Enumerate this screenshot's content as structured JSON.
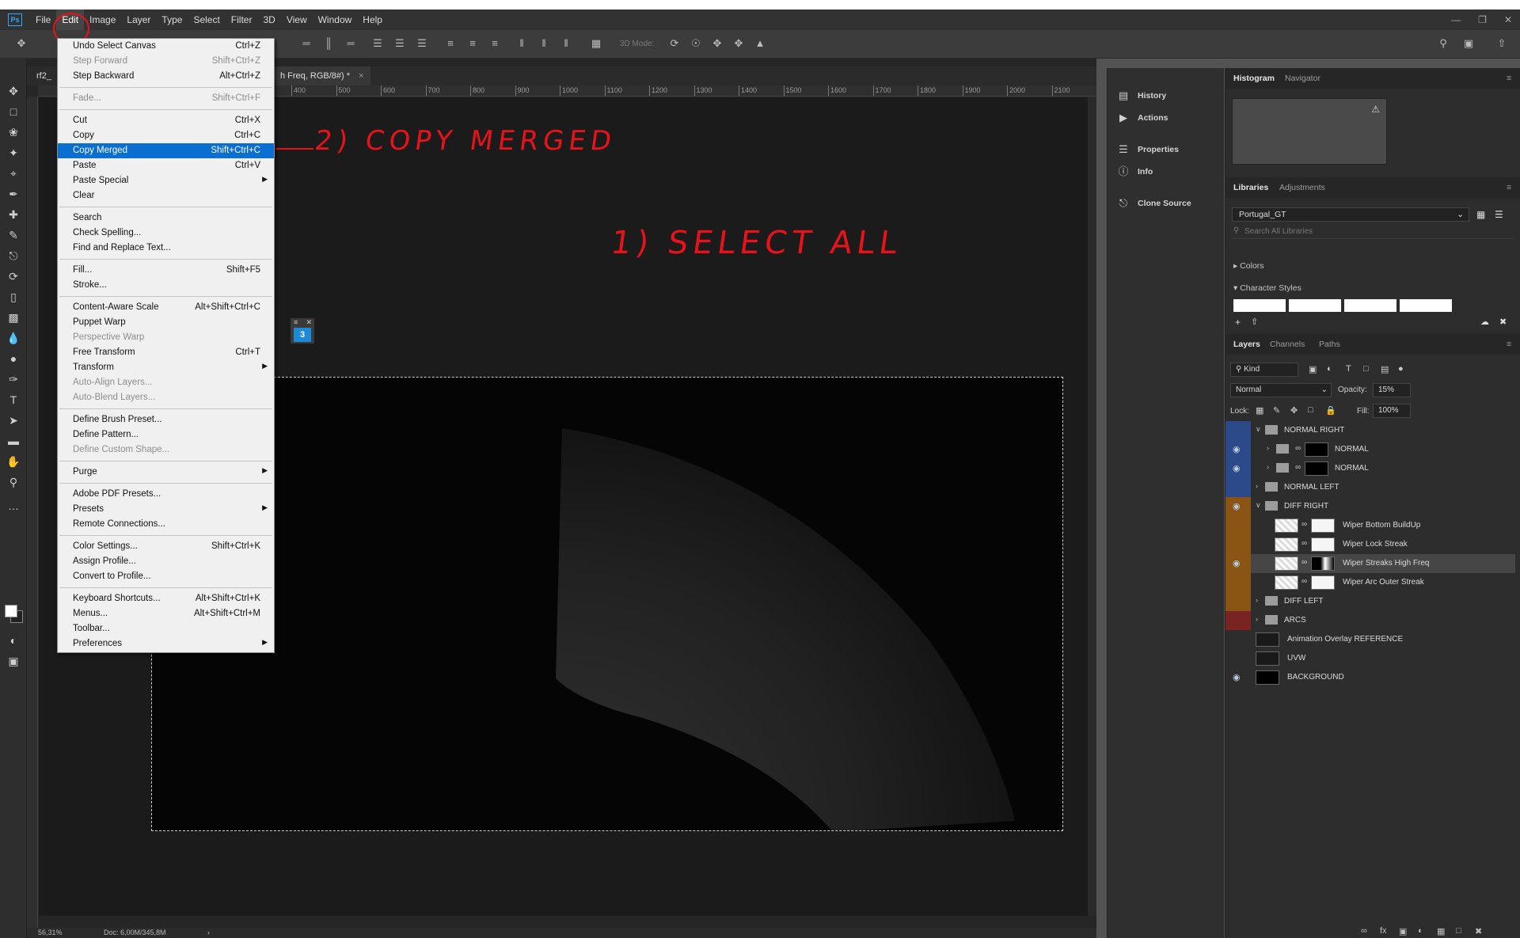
{
  "menubar": {
    "logo": "Ps",
    "items": [
      "File",
      "Edit",
      "Image",
      "Layer",
      "Type",
      "Select",
      "Filter",
      "3D",
      "View",
      "Window",
      "Help"
    ]
  },
  "optionsbar": {
    "mode_3d": "3D Mode:"
  },
  "document": {
    "tab_left": "rf2_",
    "tab_title": "h Freq, RGB/8#) *",
    "tab_close": "×",
    "ruler_ticks": [
      "400",
      "500",
      "600",
      "700",
      "800",
      "900",
      "1000",
      "1100",
      "1200",
      "1300",
      "1400",
      "1500",
      "1600",
      "1700",
      "1800",
      "1900",
      "2000",
      "2100"
    ],
    "zoom": "56,31%",
    "doc_info": "Doc: 6,00M/345,8M",
    "float_badge": "3"
  },
  "annotations": {
    "step1": "1) SELECT  ALL",
    "step2": "2) COPY  MERGED"
  },
  "edit_menu": {
    "items": [
      {
        "label": "Undo Select Canvas",
        "shortcut": "Ctrl+Z",
        "disabled": false
      },
      {
        "label": "Step Forward",
        "shortcut": "Shift+Ctrl+Z",
        "disabled": true
      },
      {
        "label": "Step Backward",
        "shortcut": "Alt+Ctrl+Z",
        "disabled": false
      },
      {
        "sep": true
      },
      {
        "label": "Fade...",
        "shortcut": "Shift+Ctrl+F",
        "disabled": true
      },
      {
        "sep": true
      },
      {
        "label": "Cut",
        "shortcut": "Ctrl+X",
        "disabled": false
      },
      {
        "label": "Copy",
        "shortcut": "Ctrl+C",
        "disabled": false
      },
      {
        "label": "Copy Merged",
        "shortcut": "Shift+Ctrl+C",
        "disabled": false,
        "highlight": true
      },
      {
        "label": "Paste",
        "shortcut": "Ctrl+V",
        "disabled": false
      },
      {
        "label": "Paste Special",
        "shortcut": "",
        "disabled": false,
        "submenu": true
      },
      {
        "label": "Clear",
        "shortcut": "",
        "disabled": false
      },
      {
        "sep": true
      },
      {
        "label": "Search",
        "shortcut": "",
        "disabled": false
      },
      {
        "label": "Check Spelling...",
        "shortcut": "",
        "disabled": false
      },
      {
        "label": "Find and Replace Text...",
        "shortcut": "",
        "disabled": false
      },
      {
        "sep": true
      },
      {
        "label": "Fill...",
        "shortcut": "Shift+F5",
        "disabled": false
      },
      {
        "label": "Stroke...",
        "shortcut": "",
        "disabled": false
      },
      {
        "sep": true
      },
      {
        "label": "Content-Aware Scale",
        "shortcut": "Alt+Shift+Ctrl+C",
        "disabled": false
      },
      {
        "label": "Puppet Warp",
        "shortcut": "",
        "disabled": false
      },
      {
        "label": "Perspective Warp",
        "shortcut": "",
        "disabled": true
      },
      {
        "label": "Free Transform",
        "shortcut": "Ctrl+T",
        "disabled": false
      },
      {
        "label": "Transform",
        "shortcut": "",
        "disabled": false,
        "submenu": true
      },
      {
        "label": "Auto-Align Layers...",
        "shortcut": "",
        "disabled": true
      },
      {
        "label": "Auto-Blend Layers...",
        "shortcut": "",
        "disabled": true
      },
      {
        "sep": true
      },
      {
        "label": "Define Brush Preset...",
        "shortcut": "",
        "disabled": false
      },
      {
        "label": "Define Pattern...",
        "shortcut": "",
        "disabled": false
      },
      {
        "label": "Define Custom Shape...",
        "shortcut": "",
        "disabled": true
      },
      {
        "sep": true
      },
      {
        "label": "Purge",
        "shortcut": "",
        "disabled": false,
        "submenu": true
      },
      {
        "sep": true
      },
      {
        "label": "Adobe PDF Presets...",
        "shortcut": "",
        "disabled": false
      },
      {
        "label": "Presets",
        "shortcut": "",
        "disabled": false,
        "submenu": true
      },
      {
        "label": "Remote Connections...",
        "shortcut": "",
        "disabled": false
      },
      {
        "sep": true
      },
      {
        "label": "Color Settings...",
        "shortcut": "Shift+Ctrl+K",
        "disabled": false
      },
      {
        "label": "Assign Profile...",
        "shortcut": "",
        "disabled": false
      },
      {
        "label": "Convert to Profile...",
        "shortcut": "",
        "disabled": false
      },
      {
        "sep": true
      },
      {
        "label": "Keyboard Shortcuts...",
        "shortcut": "Alt+Shift+Ctrl+K",
        "disabled": false
      },
      {
        "label": "Menus...",
        "shortcut": "Alt+Shift+Ctrl+M",
        "disabled": false
      },
      {
        "label": "Toolbar...",
        "shortcut": "",
        "disabled": false
      },
      {
        "label": "Preferences",
        "shortcut": "",
        "disabled": false,
        "submenu": true
      }
    ]
  },
  "icon_strip": {
    "items": [
      {
        "label": "History",
        "icon": "history-icon"
      },
      {
        "label": "Actions",
        "icon": "play-icon"
      },
      {
        "label": "Properties",
        "icon": "properties-icon"
      },
      {
        "label": "Info",
        "icon": "info-icon"
      },
      {
        "label": "Clone Source",
        "icon": "clone-source-icon"
      }
    ]
  },
  "panels": {
    "top_tabs": [
      "Histogram",
      "Navigator"
    ],
    "lib_tabs": [
      "Libraries",
      "Adjustments"
    ],
    "library_name": "Portugal_GT",
    "search_placeholder": "Search All Libraries",
    "colors_label": "Colors",
    "char_styles_label": "Character Styles",
    "layer_tabs": [
      "Layers",
      "Channels",
      "Paths"
    ],
    "filter_kind": "Kind",
    "blend_mode": "Normal",
    "opacity_label": "Opacity:",
    "opacity_value": "15%",
    "lock_label": "Lock:",
    "fill_label": "Fill:",
    "fill_value": "100%"
  },
  "colors": {
    "accent": "#0a6fd1",
    "annotation": "#e8121a",
    "blue_tag": "#2c4a8a",
    "orange_tag": "#8a5414",
    "red_tag": "#7a2323"
  },
  "layers": [
    {
      "name": "NORMAL RIGHT",
      "type": "group",
      "indent": 0,
      "tag": "blue",
      "eye": false,
      "open": true
    },
    {
      "name": "NORMAL",
      "type": "group",
      "indent": 1,
      "tag": "blue",
      "eye": true,
      "open": false
    },
    {
      "name": "NORMAL",
      "type": "group",
      "indent": 1,
      "tag": "blue",
      "eye": true,
      "open": false
    },
    {
      "name": "NORMAL LEFT",
      "type": "group",
      "indent": 0,
      "tag": "blue",
      "eye": false,
      "open": false
    },
    {
      "name": "DIFF RIGHT",
      "type": "group",
      "indent": 0,
      "tag": "orange",
      "eye": true,
      "open": true
    },
    {
      "name": "Wiper Bottom BuildUp",
      "type": "layer",
      "indent": 1,
      "tag": "orange",
      "eye": false
    },
    {
      "name": "Wiper Lock Streak",
      "type": "layer",
      "indent": 1,
      "tag": "orange",
      "eye": false
    },
    {
      "name": "Wiper Streaks High Freq",
      "type": "layer",
      "indent": 1,
      "tag": "orange",
      "eye": true,
      "selected": true
    },
    {
      "name": "Wiper Arc Outer Streak",
      "type": "layer",
      "indent": 1,
      "tag": "orange",
      "eye": false
    },
    {
      "name": "DIFF LEFT",
      "type": "group",
      "indent": 0,
      "tag": "orange",
      "eye": false,
      "open": false
    },
    {
      "name": "ARCS",
      "type": "group",
      "indent": 0,
      "tag": "red",
      "eye": false,
      "open": false
    },
    {
      "name": "Animation Overlay REFERENCE",
      "type": "plain",
      "indent": 0,
      "tag": "none",
      "eye": false
    },
    {
      "name": "UVW",
      "type": "plain",
      "indent": 0,
      "tag": "none",
      "eye": false
    },
    {
      "name": "BACKGROUND",
      "type": "plain",
      "indent": 0,
      "tag": "none",
      "eye": true
    }
  ]
}
